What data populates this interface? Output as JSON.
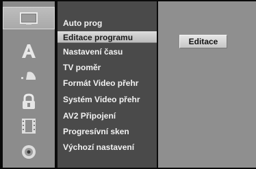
{
  "icons": [
    {
      "name": "display-icon",
      "selected": true
    },
    {
      "name": "language-icon",
      "selected": false
    },
    {
      "name": "audio-icon",
      "selected": false
    },
    {
      "name": "lock-icon",
      "selected": false
    },
    {
      "name": "film-icon",
      "selected": false
    },
    {
      "name": "disc-icon",
      "selected": false
    }
  ],
  "menu": {
    "items": [
      {
        "label": "Auto prog"
      },
      {
        "label": "Editace programu",
        "selected": true
      },
      {
        "label": "Nastavení času"
      },
      {
        "label": "TV poměr"
      },
      {
        "label": "Formát Video přehr"
      },
      {
        "label": "Systém Video přehr"
      },
      {
        "label": "AV2 Připojení"
      },
      {
        "label": "Progresívní sken"
      },
      {
        "label": "Výchozí nastavení"
      }
    ]
  },
  "value_panel": {
    "button_label": "Editace"
  }
}
